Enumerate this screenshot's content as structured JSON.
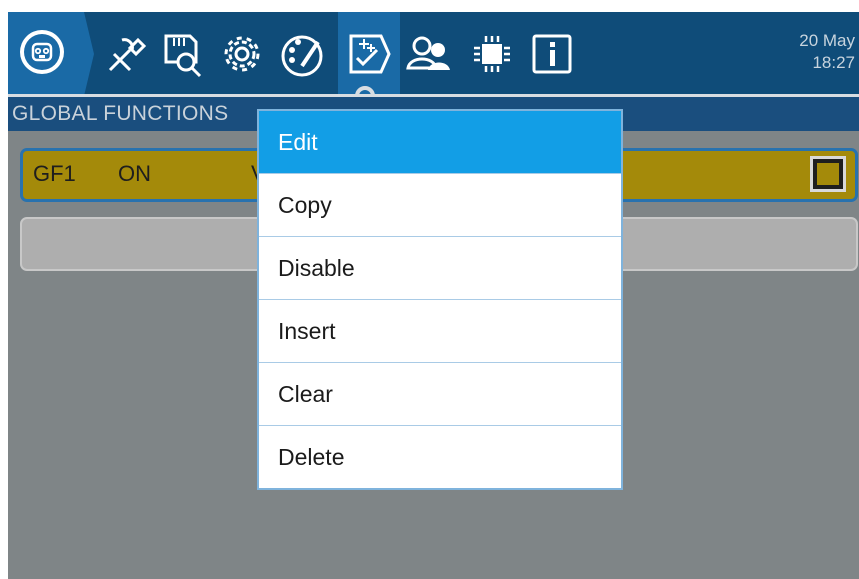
{
  "topbar": {
    "date": "20 May",
    "time": "18:27",
    "icons": [
      "model-icon",
      "tools-icon",
      "sd-card-icon",
      "gear-icon",
      "palette-icon",
      "special-functions-icon",
      "users-icon",
      "hardware-chip-icon",
      "info-icon"
    ],
    "active": "special-functions-icon"
  },
  "title": "GLOBAL FUNCTIONS",
  "rows": [
    {
      "label": "GF1",
      "state": "ON",
      "value": "V"
    }
  ],
  "menu": {
    "items": [
      "Edit",
      "Copy",
      "Disable",
      "Insert",
      "Clear",
      "Delete"
    ],
    "selected": "Edit"
  },
  "colors": {
    "topbar": "#0f4c79",
    "tab_active": "#1a6aa6",
    "row_active": "#a48a0a",
    "menu_selected": "#129ee6"
  }
}
